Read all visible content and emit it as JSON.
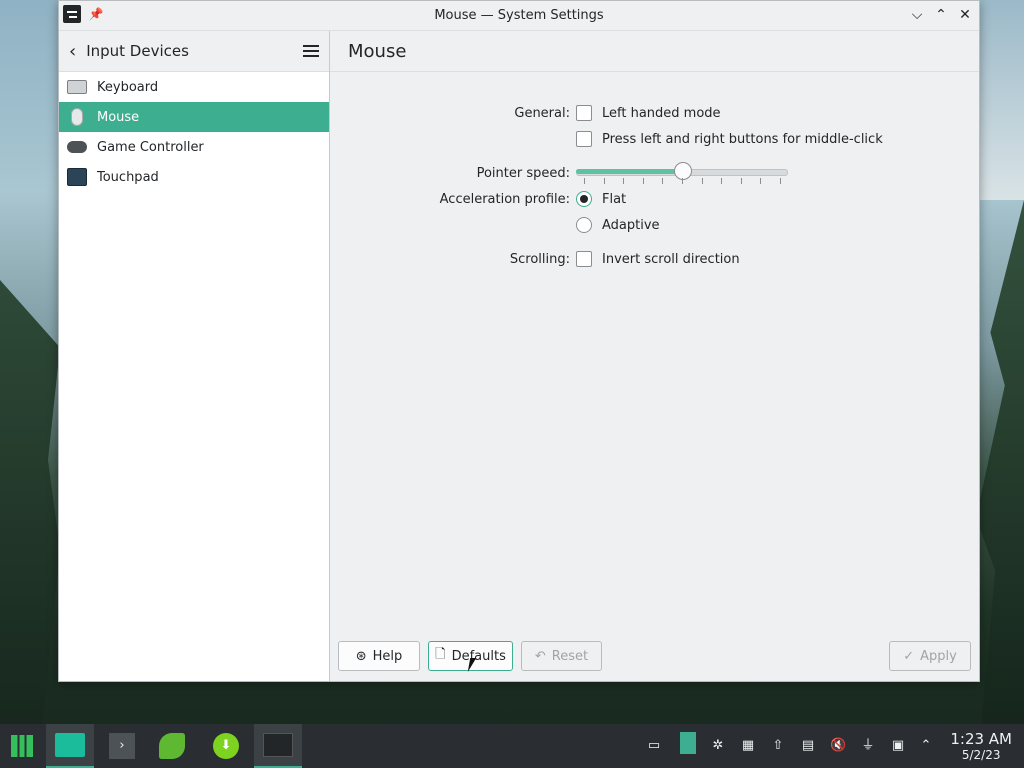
{
  "window": {
    "title": "Mouse — System Settings",
    "controls": [
      "minimize",
      "maximize",
      "close"
    ]
  },
  "sidebar": {
    "title": "Input Devices",
    "items": [
      {
        "label": "Keyboard",
        "icon": "keyboard-icon",
        "active": false
      },
      {
        "label": "Mouse",
        "icon": "mouse-icon",
        "active": true
      },
      {
        "label": "Game Controller",
        "icon": "gamepad-icon",
        "active": false
      },
      {
        "label": "Touchpad",
        "icon": "touchpad-icon",
        "active": false
      }
    ]
  },
  "content": {
    "title": "Mouse",
    "general": {
      "label": "General:",
      "left_handed": "Left handed mode",
      "middle_click": "Press left and right buttons for middle-click"
    },
    "pointer": {
      "label": "Pointer speed:",
      "value_fraction": 0.5,
      "ticks": 11
    },
    "acceleration": {
      "label": "Acceleration profile:",
      "flat": "Flat",
      "adaptive": "Adaptive",
      "selected": "Flat"
    },
    "scrolling": {
      "label": "Scrolling:",
      "invert": "Invert scroll direction"
    }
  },
  "footer": {
    "help": "Help",
    "defaults": "Defaults",
    "reset": "Reset",
    "apply": "Apply"
  },
  "taskbar": {
    "time": "1:23 AM",
    "date": "5/2/23",
    "accent": "#3dae8f"
  }
}
